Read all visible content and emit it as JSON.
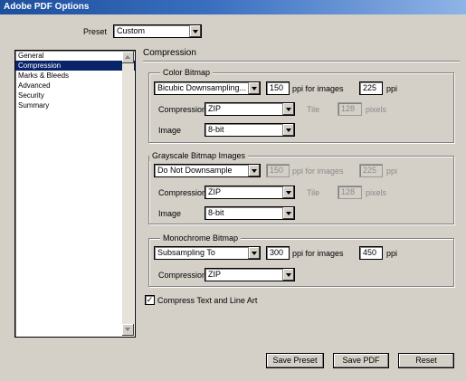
{
  "window": {
    "title": "Adobe PDF Options"
  },
  "preset": {
    "label": "Preset",
    "value": "Custom"
  },
  "sidebar": {
    "items": [
      {
        "label": "General",
        "selected": false
      },
      {
        "label": "Compression",
        "selected": true
      },
      {
        "label": "Marks & Bleeds",
        "selected": false
      },
      {
        "label": "Advanced",
        "selected": false
      },
      {
        "label": "Security",
        "selected": false
      },
      {
        "label": "Summary",
        "selected": false
      }
    ]
  },
  "panel": {
    "title": "Compression"
  },
  "color_bitmap": {
    "title": "Color Bitmap",
    "sampling": "Bicubic Downsampling...",
    "ppi_value": "150",
    "for_images_label": "ppi for images",
    "threshold_value": "225",
    "threshold_unit": "ppi",
    "compression_label": "Compression",
    "compression_value": "ZIP",
    "tile_label": "Tile",
    "tile_value": "128",
    "tile_unit": "pixels",
    "image_label": "Image",
    "image_value": "8-bit"
  },
  "grayscale_bitmap": {
    "title": "Grayscale Bitmap Images",
    "sampling": "Do Not Downsample",
    "ppi_value": "150",
    "for_images_label": "ppi for images",
    "threshold_value": "225",
    "threshold_unit": "ppi",
    "compression_label": "Compression",
    "compression_value": "ZIP",
    "tile_label": "Tile",
    "tile_value": "128",
    "tile_unit": "pixels",
    "image_label": "Image",
    "image_value": "8-bit"
  },
  "monochrome_bitmap": {
    "title": "Monochrome Bitmap",
    "sampling": "Subsampling To",
    "ppi_value": "300",
    "for_images_label": "ppi for images",
    "threshold_value": "450",
    "threshold_unit": "ppi",
    "compression_label": "Compression",
    "compression_value": "ZIP"
  },
  "compress_text": {
    "label": "Compress Text and Line Art",
    "checked": true,
    "mark": "✓"
  },
  "buttons": {
    "save_preset": "Save Preset",
    "save_pdf": "Save PDF",
    "reset": "Reset"
  },
  "colors": {
    "title_bar": "#1c4f9c",
    "selection": "#0a246a",
    "face": "#d4d0c8"
  },
  "icons": {
    "dropdown": "chevron-down-icon",
    "scroll_up": "scroll-up-icon",
    "scroll_down": "scroll-down-icon"
  }
}
